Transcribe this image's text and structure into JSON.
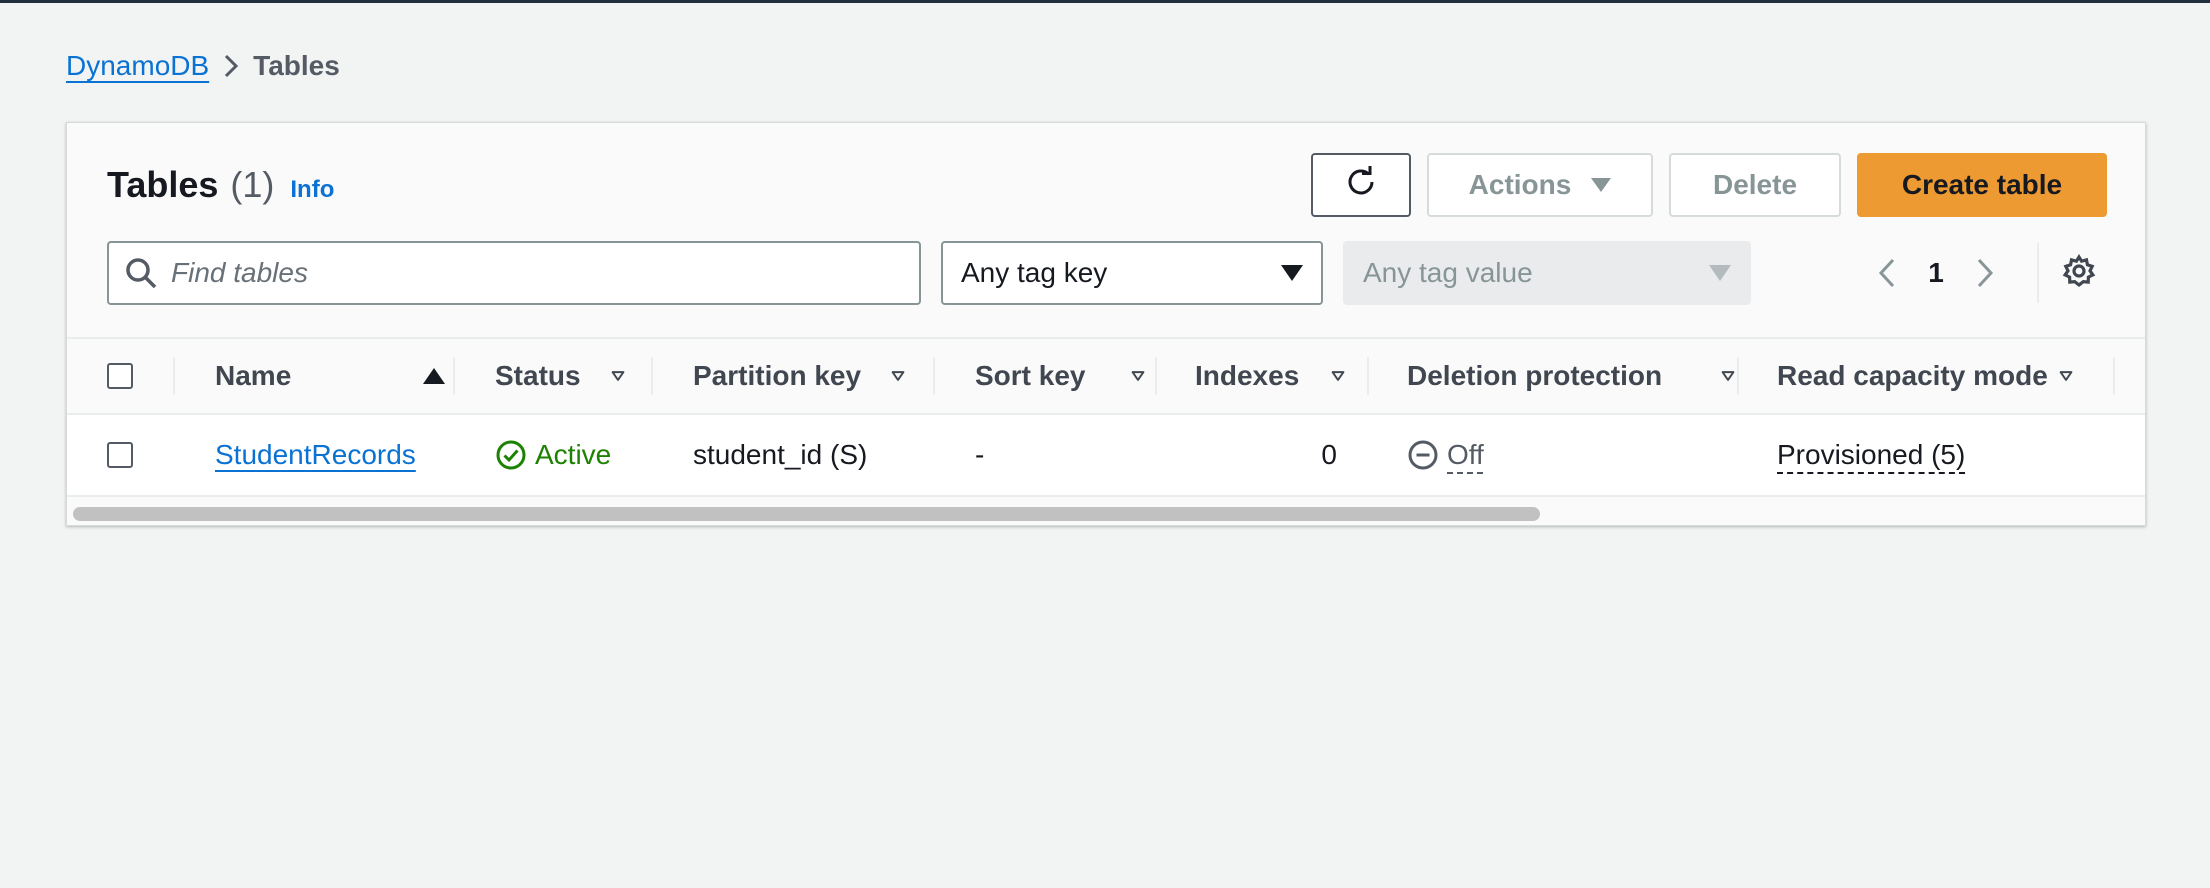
{
  "breadcrumb": {
    "root": "DynamoDB",
    "current": "Tables"
  },
  "header": {
    "title": "Tables",
    "count": "(1)",
    "info": "Info"
  },
  "toolbar": {
    "refresh_icon": "refresh-icon",
    "actions_label": "Actions",
    "delete_label": "Delete",
    "create_label": "Create table"
  },
  "filters": {
    "search_placeholder": "Find tables",
    "search_value": "",
    "tag_key": "Any tag key",
    "tag_value": "Any tag value"
  },
  "pagination": {
    "current_page": "1"
  },
  "table": {
    "columns": [
      {
        "label": "Name",
        "sort": "ascending"
      },
      {
        "label": "Status",
        "sort": "none"
      },
      {
        "label": "Partition key",
        "sort": "none"
      },
      {
        "label": "Sort key",
        "sort": "none"
      },
      {
        "label": "Indexes",
        "sort": "none"
      },
      {
        "label": "Deletion protection",
        "sort": "none"
      },
      {
        "label": "Read capacity mode",
        "sort": "none"
      }
    ],
    "rows": [
      {
        "name": "StudentRecords",
        "status": "Active",
        "partition_key": "student_id (S)",
        "sort_key": "-",
        "indexes": "0",
        "deletion_protection": "Off",
        "read_capacity_mode": "Provisioned (5)"
      }
    ]
  },
  "scrollbar": {
    "horizontal_visible_fraction": 0.71
  },
  "colors": {
    "primary_button": "#ec9a31",
    "link": "#0972d3",
    "success": "#1d8102",
    "background": "#f2f3f3"
  }
}
